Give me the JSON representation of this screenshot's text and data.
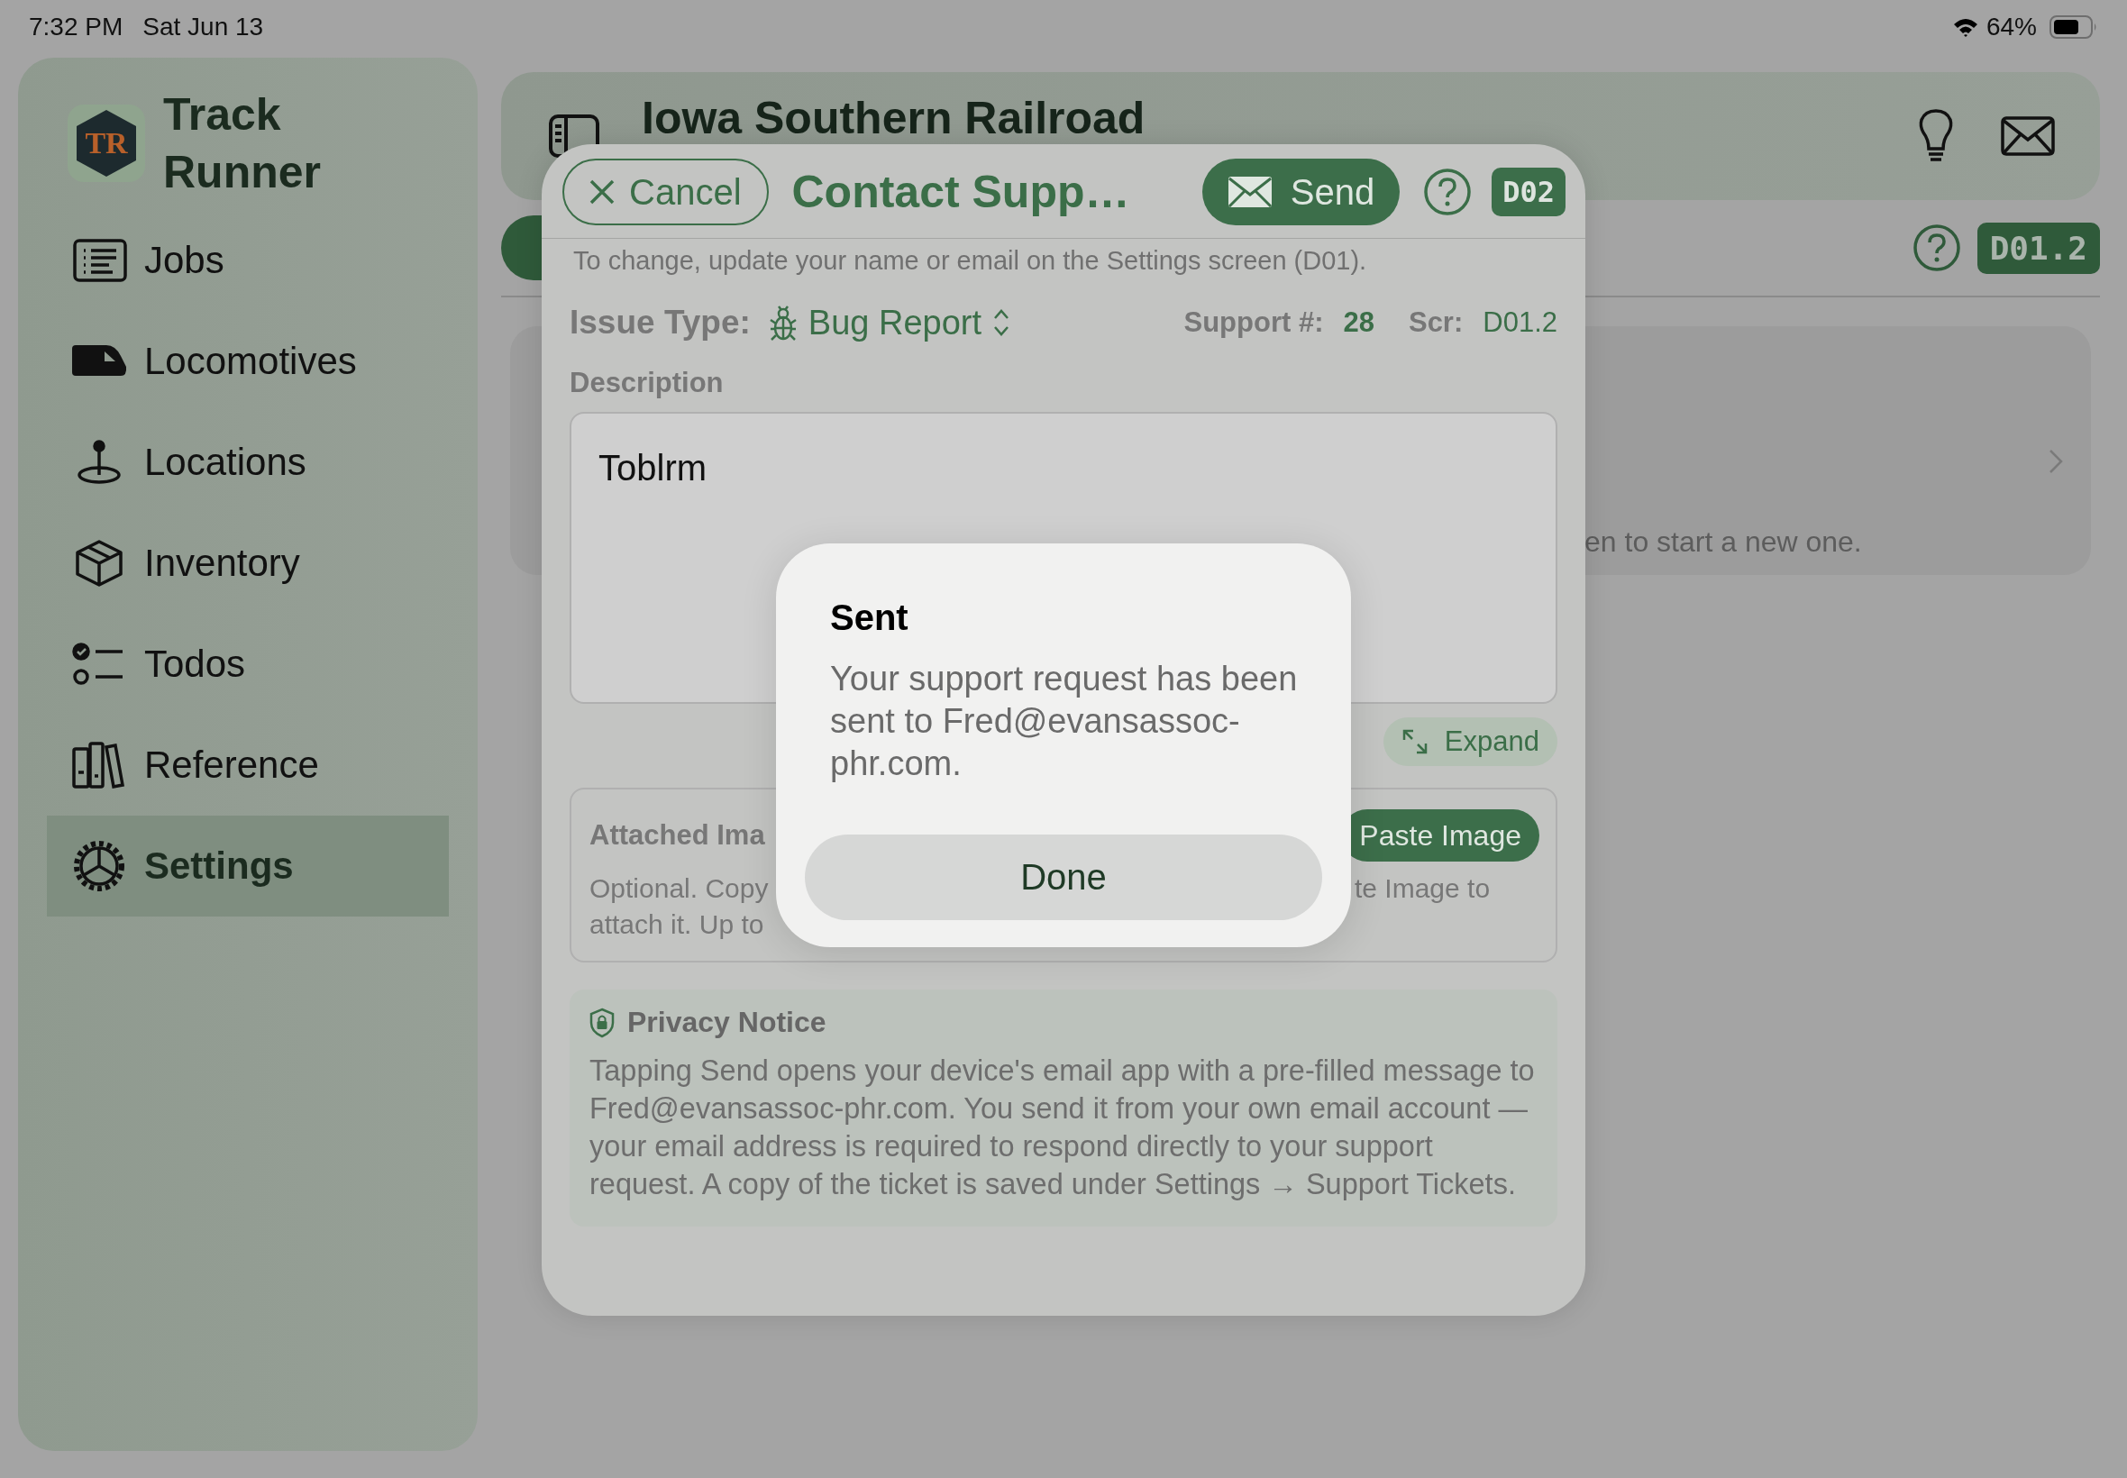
{
  "status_bar": {
    "time": "7:32 PM",
    "date": "Sat Jun 13",
    "battery": "64%"
  },
  "sidebar": {
    "app_name": "Track Runner",
    "logo_mark": "TR",
    "items": [
      {
        "label": "Jobs",
        "selected": false
      },
      {
        "label": "Locomotives",
        "selected": false
      },
      {
        "label": "Locations",
        "selected": false
      },
      {
        "label": "Inventory",
        "selected": false
      },
      {
        "label": "Todos",
        "selected": false
      },
      {
        "label": "Reference",
        "selected": false
      },
      {
        "label": "Settings",
        "selected": true
      }
    ]
  },
  "header": {
    "title": "Iowa Southern Railroad"
  },
  "toolbar": {
    "screen_code": "D01.2"
  },
  "background_card": {
    "text": "en to start a new one."
  },
  "sheet": {
    "cancel": "Cancel",
    "title": "Contact Supp…",
    "send": "Send",
    "screen_code": "D02",
    "note": "To change, update your name or email on the Settings screen (D01).",
    "issue_type_label": "Issue Type:",
    "issue_type_value": "Bug Report",
    "support_label": "Support #:",
    "support_number": "28",
    "screen_label": "Scr:",
    "screen_value": "D01.2",
    "description_label": "Description",
    "description_value": "Toblrm",
    "expand": "Expand",
    "attachments": {
      "title": "Attached Ima",
      "paste_button": "Paste Image",
      "hint_left_lines": [
        "Optional. Copy",
        "attach it. Up to"
      ],
      "hint_right": "te Image to"
    },
    "privacy": {
      "title": "Privacy Notice",
      "lines": [
        "Tapping Send opens your device's email app with a pre-filled message to",
        "Fred@evansassoc-phr.com. You send it from your own email account —",
        "your email address is required to respond directly to your support",
        "request. A copy of the ticket is saved under Settings → Support Tickets."
      ]
    }
  },
  "alert": {
    "title": "Sent",
    "message_lines": [
      "Your support request has been",
      "sent to Fred@evansassoc-",
      "phr.com."
    ],
    "button": "Done"
  }
}
